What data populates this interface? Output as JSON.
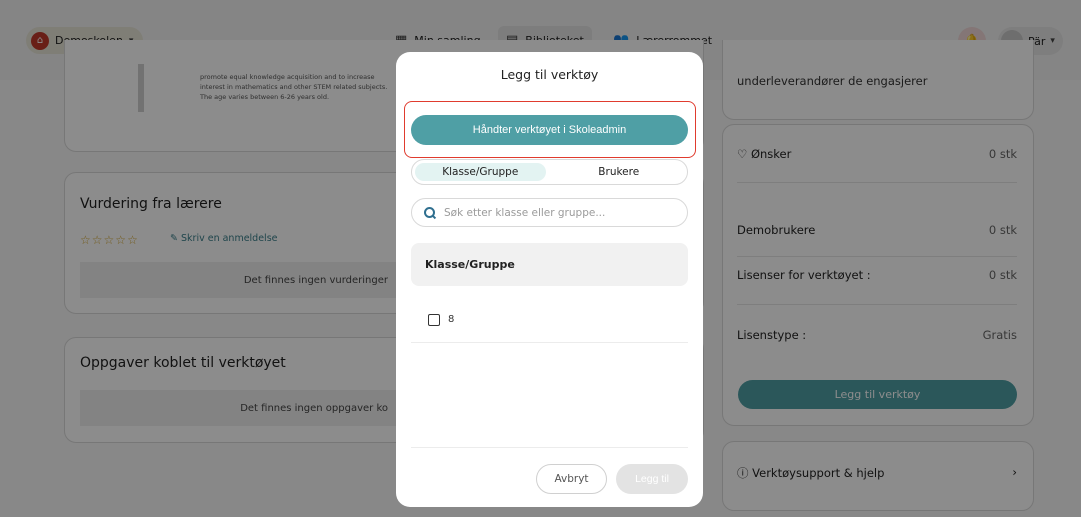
{
  "topbar": {
    "school": "Demoskolen",
    "nav": [
      {
        "label": "Min samling",
        "icon": "grid-icon"
      },
      {
        "label": "Biblioteket",
        "icon": "library-icon"
      },
      {
        "label": "Lærerrommet",
        "icon": "people-icon"
      }
    ],
    "user": "Pär"
  },
  "main": {
    "description": "promote equal knowledge acquisition and to increase interest in mathematics and other STEM related subjects. The age varies between 6-26 years old.",
    "reviews": {
      "title": "Vurdering fra lærere",
      "rating": 0,
      "write_review": "Skriv en anmeldelse",
      "empty": "Det finnes ingen vurderinger"
    },
    "tasks": {
      "title": "Oppgaver koblet til verktøyet",
      "empty": "Det finnes ingen oppgaver ko"
    }
  },
  "sidebar": {
    "subcontractors": "underleverandører de engasjerer",
    "rows": [
      {
        "label": "Ønsker",
        "value": "0 stk"
      },
      {
        "label": "Demobrukere",
        "value": "0 stk"
      },
      {
        "label": "Lisenser for verktøyet :",
        "value": "0 stk"
      },
      {
        "label": "Lisenstype :",
        "value": "Gratis"
      }
    ],
    "add_button": "Legg til verktøy",
    "support": "Verktøysupport & hjelp"
  },
  "modal": {
    "title": "Legg til verktøy",
    "manage_button": "Håndter verktøyet i Skoleadmin",
    "tabs": [
      "Klasse/Gruppe",
      "Brukere"
    ],
    "search_placeholder": "Søk etter klasse eller gruppe...",
    "table_header": "Klasse/Gruppe",
    "rows": [
      {
        "label": "8"
      }
    ],
    "cancel": "Avbryt",
    "add": "Legg til"
  },
  "colors": {
    "accent": "#4f9fa5",
    "highlight": "#e03b2e"
  }
}
